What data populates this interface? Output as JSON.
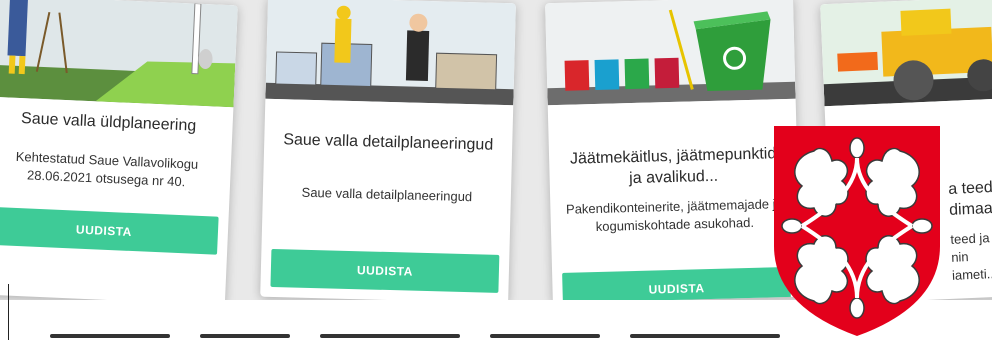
{
  "cards": [
    {
      "title": "Saue valla üldplaneering",
      "description": "Kehtestatud Saue Vallavolikogu 28.06.2021 otsusega nr 40.",
      "button_label": "UUDISTA"
    },
    {
      "title": "Saue valla detailplaneeringud",
      "description": "Saue valla detailplaneeringud",
      "button_label": "UUDISTA"
    },
    {
      "title": "Jäätmekäitlus, jäätmepunktid ja avalikud...",
      "description": "Pakendikonteinerite, jäätmemajade ja kogumiskohtade asukohad.",
      "button_label": "UUDISTA"
    },
    {
      "title": "a teed j dimaac",
      "description": "teed ja aad nin iameti..."
    }
  ],
  "colors": {
    "button": "#3ecb97",
    "crest_red": "#e3001b",
    "crest_white": "#ffffff"
  },
  "icons": {
    "crest": "saue-coat-of-arms-icon",
    "card1": "surveyor-illustration",
    "card2": "planning-illustration",
    "card3": "waste-bins-illustration",
    "card4": "road-roller-illustration"
  }
}
